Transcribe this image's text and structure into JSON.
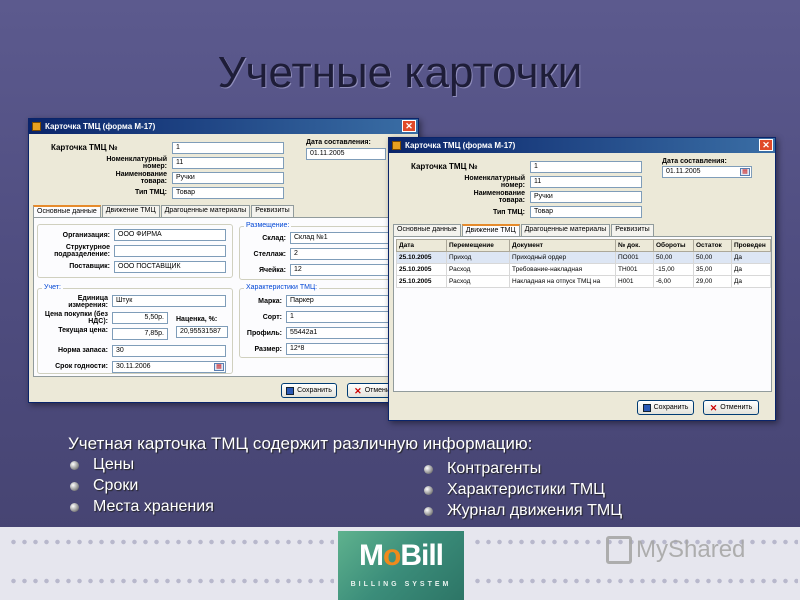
{
  "slide": {
    "title": "Учетные карточки",
    "caption": "Учетная карточка ТМЦ содержит различную информацию:",
    "bullets_left": [
      "Цены",
      "Сроки",
      "Места хранения"
    ],
    "bullets_right": [
      "Контрагенты",
      "Характеристики ТМЦ",
      "Журнал движения ТМЦ"
    ]
  },
  "window1": {
    "title": "Карточка ТМЦ (форма М-17)",
    "card_no_label": "Карточка ТМЦ №",
    "card_no": "1",
    "nomenclature_label": "Номенклатурный номер:",
    "nomenclature": "11",
    "name_label": "Наименование товара:",
    "name": "Ручки",
    "type_label": "Тип ТМЦ:",
    "type": "Товар",
    "date_label": "Дата составления:",
    "date": "01.11.2005",
    "tabs": [
      "Основные данные",
      "Движение ТМЦ",
      "Драгоценные материалы",
      "Реквизиты"
    ],
    "org_label": "Организация:",
    "org": "ООО ФИРМА",
    "division_label": "Структурное подразделение:",
    "division": "",
    "supplier_label": "Поставщик:",
    "supplier": "ООО ПОСТАВЩИК",
    "placement_group": "Размещение:",
    "warehouse_label": "Склад:",
    "warehouse": "Склад №1",
    "rack_label": "Стеллаж:",
    "rack": "2",
    "cell_label": "Ячейка:",
    "cell": "12",
    "account_group": "Учет:",
    "unit_label": "Единица измерения:",
    "unit": "Штук",
    "price_label": "Цена покупки (без НДС):",
    "price": "5,50р.",
    "markup_label": "Наценка, %:",
    "markup": "20,95531587",
    "current_price_label": "Текущая цена:",
    "current_price": "7,85р.",
    "stock_norm_label": "Норма запаса:",
    "stock_norm": "30",
    "expiry_label": "Срок годности:",
    "expiry": "30.11.2006",
    "chars_group": "Характеристики ТМЦ:",
    "brand_label": "Марка:",
    "brand": "Паркер",
    "grade_label": "Сорт:",
    "grade": "1",
    "profile_label": "Профиль:",
    "profile": "55442а1",
    "size_label": "Размер:",
    "size": "12*8",
    "save": "Сохранить",
    "cancel": "Отмени"
  },
  "window2": {
    "title": "Карточка ТМЦ (форма М-17)",
    "card_no_label": "Карточка ТМЦ №",
    "card_no": "1",
    "nomenclature_label": "Номенклатурный номер:",
    "nomenclature": "11",
    "name_label": "Наименование товара:",
    "name": "Ручки",
    "type_label": "Тип ТМЦ:",
    "type": "Товар",
    "date_label": "Дата составления:",
    "date": "01.11.2005",
    "tabs": [
      "Основные данные",
      "Движение ТМЦ",
      "Драгоценные материалы",
      "Реквизиты"
    ],
    "columns": [
      "Дата",
      "Перемещение",
      "Документ",
      "№ док.",
      "Обороты",
      "Остаток",
      "Проведен"
    ],
    "rows": [
      [
        "25.10.2005",
        "Приход",
        "Приходный ордер",
        "ПО001",
        "50,00",
        "50,00",
        "Да"
      ],
      [
        "25.10.2005",
        "Расход",
        "Требование-накладная",
        "ТН001",
        "-15,00",
        "35,00",
        "Да"
      ],
      [
        "25.10.2005",
        "Расход",
        "Накладная на отпуск ТМЦ на",
        "Н001",
        "-6,00",
        "29,00",
        "Да"
      ]
    ],
    "save": "Сохранить",
    "cancel": "Отменить"
  },
  "footer": {
    "logo_main_1": "M",
    "logo_main_o": "o",
    "logo_main_2": "Bill",
    "logo_sub": "BILLING SYSTEM",
    "watermark": "MyShared"
  }
}
